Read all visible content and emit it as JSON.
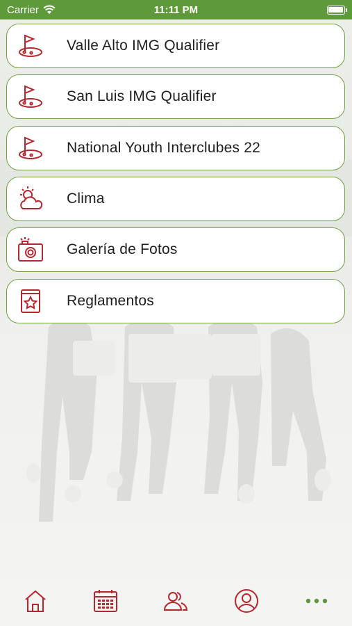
{
  "status_bar": {
    "carrier": "Carrier",
    "time": "11:11 PM"
  },
  "menu": {
    "items": [
      {
        "label": "Valle Alto IMG Qualifier",
        "icon": "golf-flag-icon"
      },
      {
        "label": "San Luis IMG Qualifier",
        "icon": "golf-flag-icon"
      },
      {
        "label": "National Youth Interclubes 22",
        "icon": "golf-flag-icon"
      },
      {
        "label": "Clima",
        "icon": "weather-icon"
      },
      {
        "label": "Galería de Fotos",
        "icon": "camera-icon"
      },
      {
        "label": "Reglamentos",
        "icon": "rulebook-icon"
      }
    ]
  },
  "tab_bar": {
    "tabs": [
      {
        "icon": "home-icon"
      },
      {
        "icon": "calendar-icon"
      },
      {
        "icon": "users-icon"
      },
      {
        "icon": "profile-icon"
      },
      {
        "icon": "more-icon",
        "active": true
      }
    ]
  },
  "colors": {
    "brand_green": "#5f9a3a",
    "border_green": "#6ea23f",
    "icon_red": "#b5272d"
  }
}
